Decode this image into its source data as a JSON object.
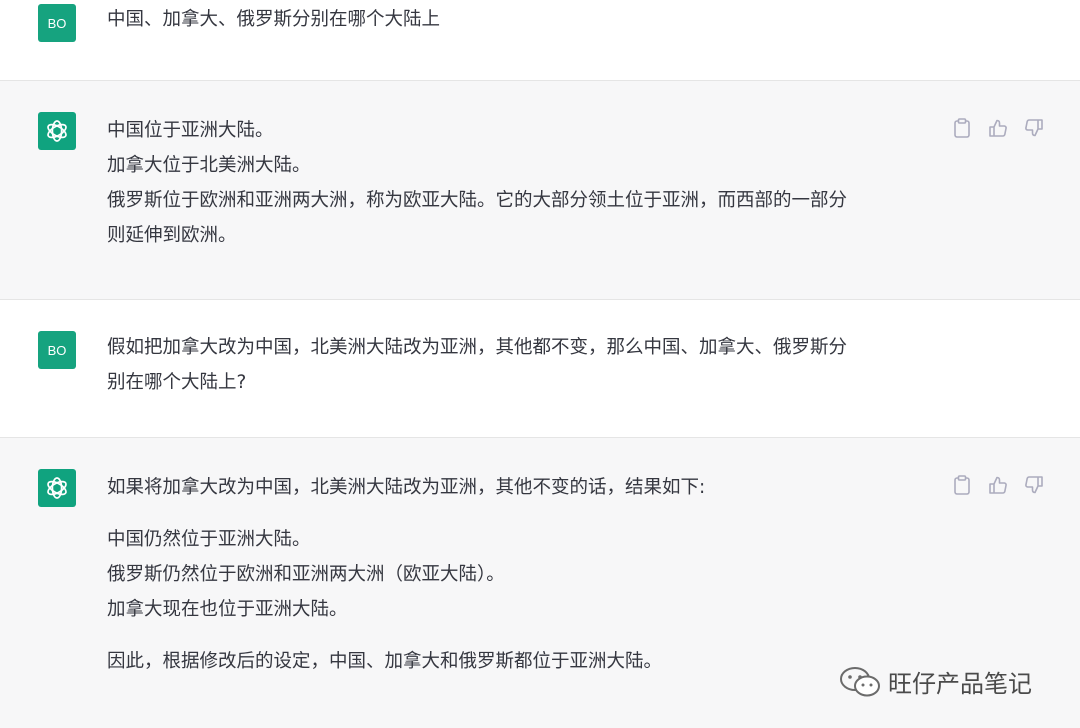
{
  "conversation": [
    {
      "role": "user",
      "avatar_text": "BO",
      "lines": [
        "中国、加拿大、俄罗斯分别在哪个大陆上"
      ]
    },
    {
      "role": "assistant",
      "avatar_icon": "chatgpt-logo-icon",
      "lines": [
        "中国位于亚洲大陆。",
        "加拿大位于北美洲大陆。",
        "俄罗斯位于欧洲和亚洲两大洲，称为欧亚大陆。它的大部分领土位于亚洲，而西部的一部分",
        "则延伸到欧洲。"
      ]
    },
    {
      "role": "user",
      "avatar_text": "BO",
      "lines": [
        "假如把加拿大改为中国，北美洲大陆改为亚洲，其他都不变，那么中国、加拿大、俄罗斯分",
        "别在哪个大陆上?"
      ]
    },
    {
      "role": "assistant",
      "avatar_icon": "chatgpt-logo-icon",
      "intro": "如果将加拿大改为中国，北美洲大陆改为亚洲，其他不变的话，结果如下:",
      "list": [
        "中国仍然位于亚洲大陆。",
        "俄罗斯仍然位于欧洲和亚洲两大洲（欧亚大陆）。",
        "加拿大现在也位于亚洲大陆。"
      ],
      "conclusion": "因此，根据修改后的设定，中国、加拿大和俄罗斯都位于亚洲大陆。"
    }
  ],
  "actions": {
    "copy_icon": "clipboard-icon",
    "like_icon": "thumbs-up-icon",
    "dislike_icon": "thumbs-down-icon"
  },
  "watermark": {
    "text": "旺仔产品笔记",
    "icon": "wechat-icon"
  },
  "colors": {
    "avatar_user": "#16a37f",
    "avatar_bot": "#10a37f",
    "bot_background": "#f7f7f8",
    "text": "#353740",
    "icon_gray": "#acacbe"
  }
}
